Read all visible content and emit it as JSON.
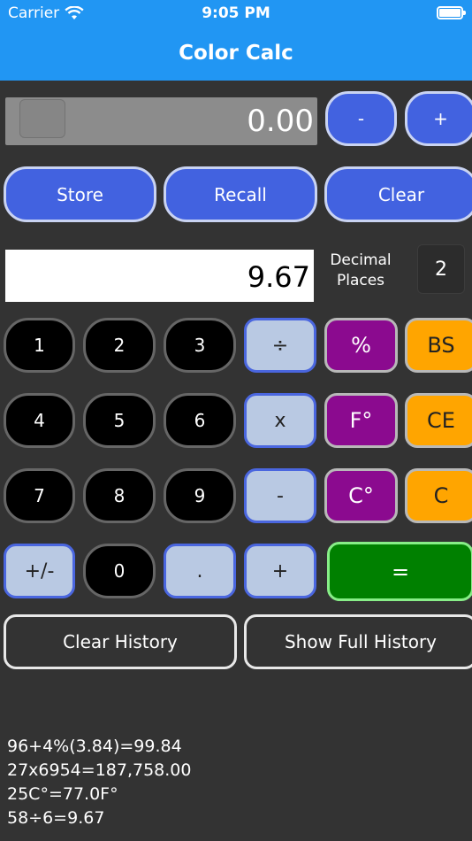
{
  "status": {
    "carrier": "Carrier",
    "time": "9:05 PM"
  },
  "app": {
    "title": "Color Calc"
  },
  "display": {
    "value": "0.00"
  },
  "memory": {
    "minus": "-",
    "plus": "+",
    "store": "Store",
    "recall": "Recall",
    "clear": "Clear"
  },
  "input": {
    "value": "9.67"
  },
  "decimal": {
    "label_line1": "Decimal",
    "label_line2": "Places",
    "value": "2"
  },
  "keys": {
    "k1": "1",
    "k2": "2",
    "k3": "3",
    "div": "÷",
    "pct": "%",
    "bs": "BS",
    "k4": "4",
    "k5": "5",
    "k6": "6",
    "mul": "x",
    "f": "F°",
    "ce": "CE",
    "k7": "7",
    "k8": "8",
    "k9": "9",
    "sub": "-",
    "c_deg": "C°",
    "c": "C",
    "neg": "+/-",
    "k0": "0",
    "dot": ".",
    "add": "+",
    "eq": "="
  },
  "history_buttons": {
    "clear": "Clear History",
    "show": "Show Full History"
  },
  "history": [
    "96+4%(3.84)=99.84",
    "27x6954=187,758.00",
    "25C°=77.0F°",
    "58÷6=9.67"
  ],
  "colors": {
    "nav": "#2196F3",
    "background": "#333333",
    "blue_button": "#4262E0",
    "purple": "#8b0a8f",
    "orange": "#FFA500",
    "green": "#008000"
  }
}
